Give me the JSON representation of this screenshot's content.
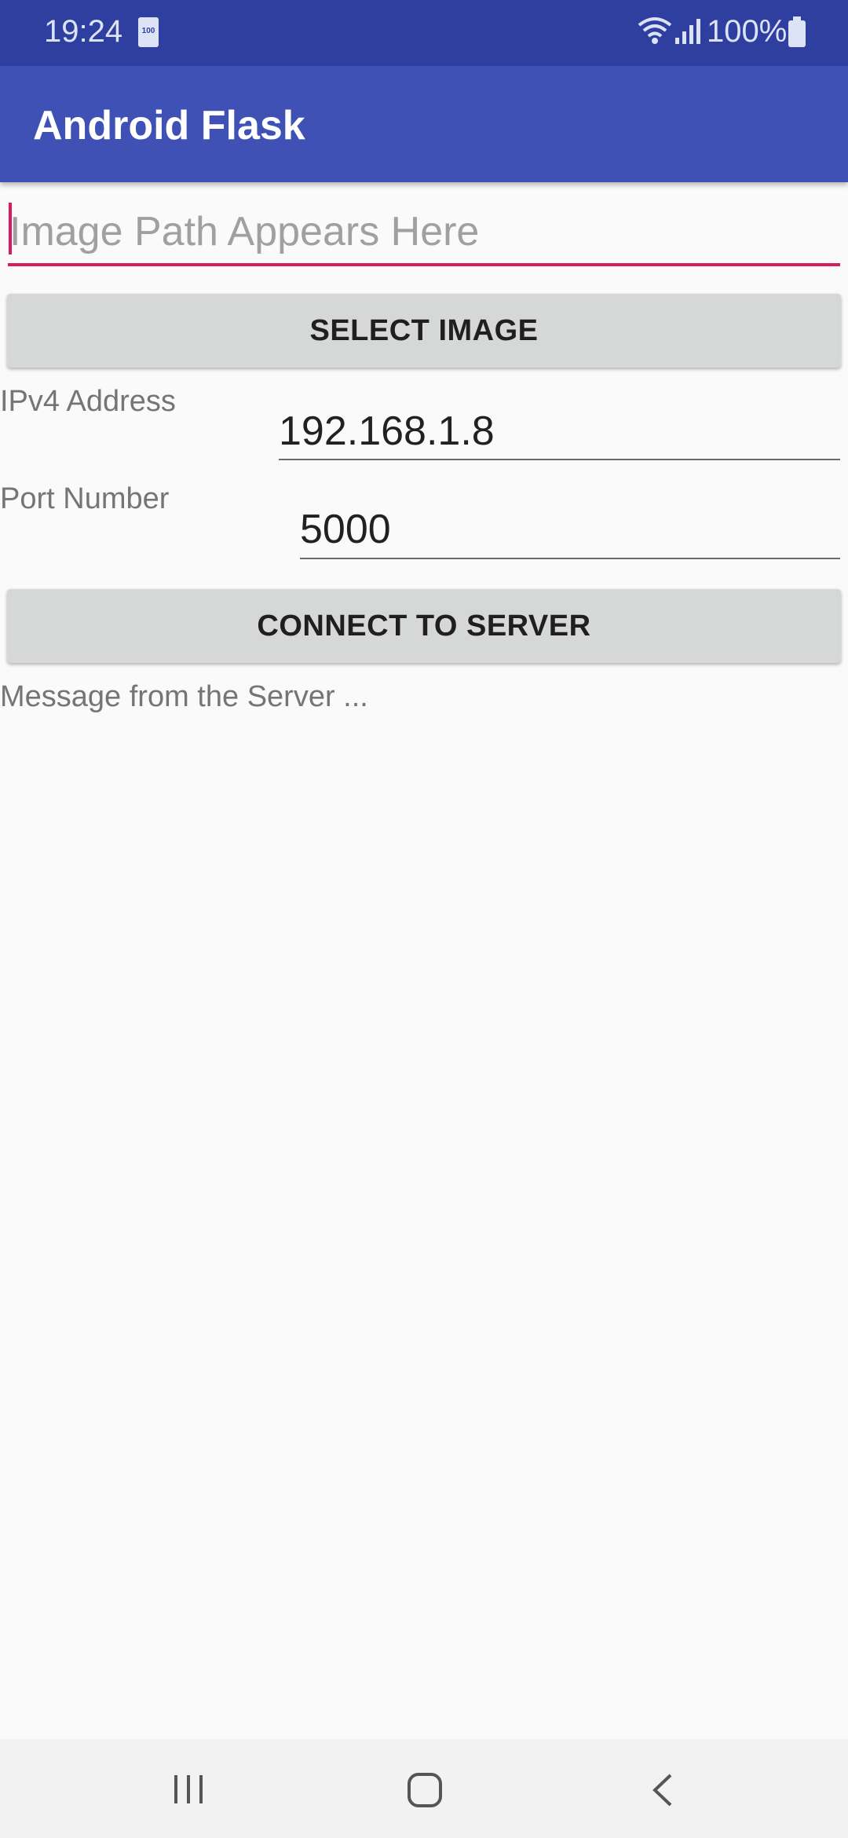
{
  "status_bar": {
    "time": "19:24",
    "battery_saver_label": "100",
    "battery_percent": "100%"
  },
  "app_bar": {
    "title": "Android Flask"
  },
  "image_path": {
    "placeholder": "Image Path Appears Here",
    "value": ""
  },
  "select_image_button": {
    "label": "SELECT IMAGE"
  },
  "ipv4": {
    "label": "IPv4 Address",
    "value": "192.168.1.8"
  },
  "port": {
    "label": "Port Number",
    "value": "5000"
  },
  "connect_button": {
    "label": "CONNECT TO SERVER"
  },
  "server_message": {
    "text": "Message from the Server ..."
  },
  "nav_bar": {
    "icons": [
      "recent-apps-icon",
      "home-icon",
      "back-icon"
    ]
  },
  "colors": {
    "status_bar": "#2f3f9f",
    "app_bar": "#3f51b5",
    "accent": "#d81b60",
    "button": "#d6d7d7",
    "background": "#fafafa"
  }
}
